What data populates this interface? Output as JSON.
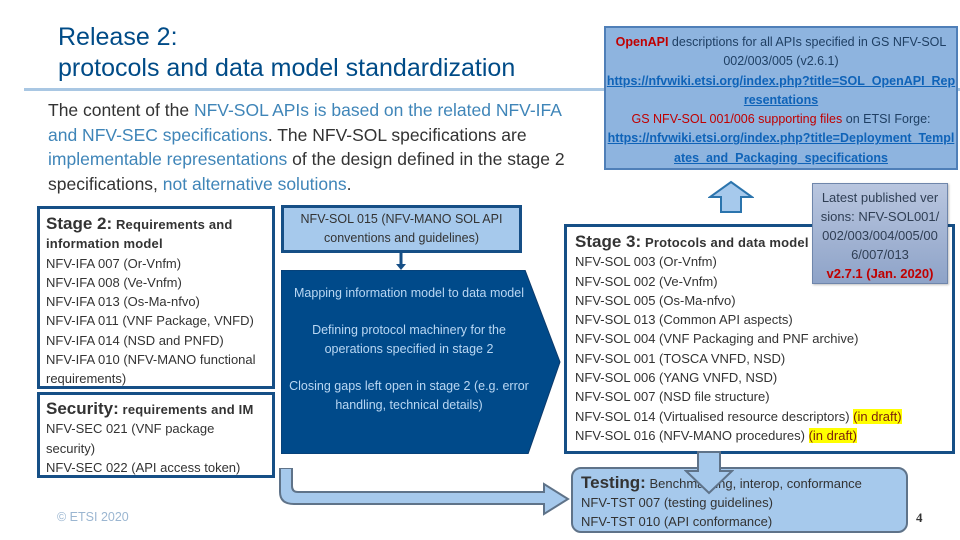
{
  "slide": {
    "title_line1": "Release 2:",
    "title_line2": "protocols and data model standardization",
    "intro": {
      "p1": "The content of the ",
      "p2": "NFV-SOL APIs is based on the related NFV-IFA and NFV-SEC specifications",
      "p3": ". The NFV-SOL specifications are ",
      "p4": "implementable representations",
      "p5": " of the design defined in the stage 2 specifications, ",
      "p6": "not alternative solutions",
      "p7": "."
    },
    "openapi": {
      "a1": "OpenAPI",
      "a2": " descriptions for all APIs specified in GS NFV-SOL 002/003/005 (v2.6.1)",
      "link1": "https://nfvwiki.etsi.org/index.php?title=SOL_OpenAPI_Representations",
      "b1": "GS NFV-SOL 001/006 supporting files",
      "b2": " on ETSI Forge:",
      "link2": "https://nfvwiki.etsi.org/index.php?title=Deployment_Templates_and_Packaging_specifications"
    },
    "stage2": {
      "head": "Stage 2:",
      "sub": " Requirements and information model",
      "items": [
        "NFV-IFA 007 (Or-Vnfm)",
        "NFV-IFA 008 (Ve-Vnfm)",
        "NFV-IFA 013 (Os-Ma-nfvo)",
        "NFV-IFA 011 (VNF Package, VNFD)",
        "NFV-IFA 014 (NSD and PNFD)",
        "NFV-IFA 010 (NFV-MANO functional requirements)"
      ]
    },
    "security": {
      "head": "Security:",
      "sub": " requirements and IM",
      "items": [
        "NFV-SEC 021 (VNF package security)",
        "NFV-SEC 022 (API access token)"
      ]
    },
    "sol015": "NFV-SOL 015 (NFV-MANO SOL API conventions and guidelines)",
    "process": [
      "Mapping information model to data model",
      "Defining protocol machinery for the operations specified in stage 2",
      "Closing gaps left open in stage 2 (e.g. error handling, technical details)"
    ],
    "stage3": {
      "head": "Stage 3:",
      "sub": " Protocols and data model",
      "items": [
        {
          "text": "NFV-SOL 003 (Or-Vnfm)",
          "draft": ""
        },
        {
          "text": "NFV-SOL 002 (Ve-Vnfm)",
          "draft": ""
        },
        {
          "text": "NFV-SOL 005 (Os-Ma-nfvo)",
          "draft": ""
        },
        {
          "text": "NFV-SOL 013 (Common API aspects)",
          "draft": ""
        },
        {
          "text": "NFV-SOL 004 (VNF Packaging and PNF archive)",
          "draft": ""
        },
        {
          "text": "NFV-SOL 001 (TOSCA VNFD, NSD)",
          "draft": ""
        },
        {
          "text": "NFV-SOL 006 (YANG VNFD, NSD)",
          "draft": ""
        },
        {
          "text": "NFV-SOL 007 (NSD file structure)",
          "draft": ""
        },
        {
          "text": "NFV-SOL 014 (Virtualised resource descriptors) ",
          "draft": "(in draft)"
        },
        {
          "text": "NFV-SOL 016 (NFV-MANO procedures) ",
          "draft": "(in draft)"
        }
      ]
    },
    "latest": {
      "text": "Latest published versions: NFV-SOL001/002/003/004/005/006/007/013",
      "version": "v2.7.1 (Jan. 2020)"
    },
    "testing": {
      "head": "Testing:",
      "sub": " Benchmarking, interop, conformance",
      "items": [
        "NFV-TST 007 (testing guidelines)",
        "NFV-TST 010 (API conformance)"
      ]
    },
    "footer": "© ETSI 2020",
    "page_number": "4"
  },
  "colors": {
    "title": "#004b87",
    "accent_text": "#3f85b8",
    "dark_blue": "#164f86",
    "light_blue": "#a6c9ec",
    "highlight": "#ffff00",
    "red": "#c00000"
  }
}
